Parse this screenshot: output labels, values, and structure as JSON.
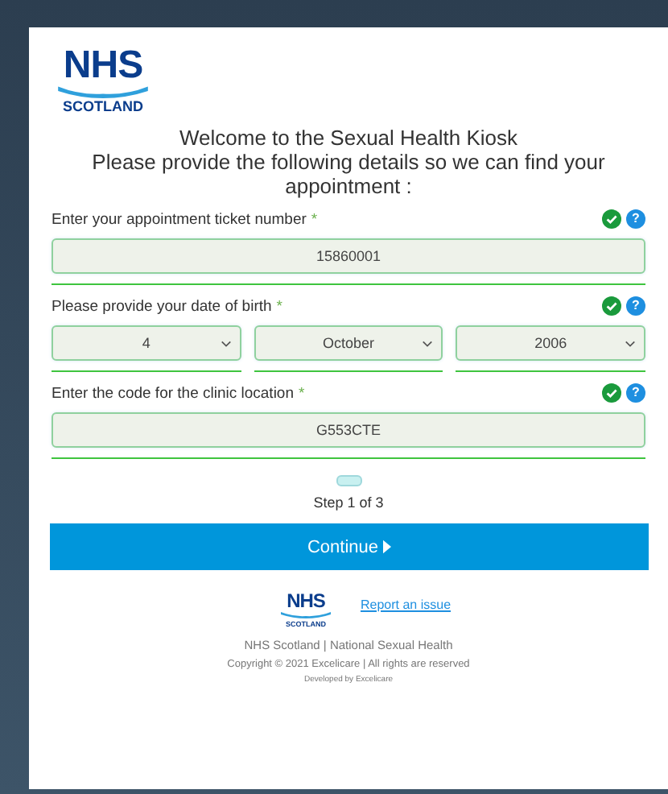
{
  "logo": {
    "name": "NHS",
    "region": "SCOTLAND"
  },
  "heading": [
    "Welcome to the Sexual Health Kiosk",
    "Please provide the following details so we can find your appointment :"
  ],
  "fields": [
    {
      "kind": "text",
      "label": "Enter your appointment ticket number",
      "required_mark": "*",
      "valid": true,
      "help": "?",
      "values": [
        "15860001"
      ]
    },
    {
      "kind": "select",
      "label": "Please provide your date of birth",
      "required_mark": "*",
      "valid": true,
      "help": "?",
      "values": [
        "4",
        "October",
        "2006"
      ]
    },
    {
      "kind": "text",
      "label": "Enter the code for the clinic location",
      "required_mark": "*",
      "valid": true,
      "help": "?",
      "values": [
        "G553CTE"
      ]
    }
  ],
  "step": "Step 1 of 3",
  "continue_button": "Continue",
  "footer": {
    "logo": {
      "name": "NHS",
      "region": "SCOTLAND"
    },
    "link": "Report an issue",
    "lines": [
      "NHS Scotland | National Sexual Health",
      "Copyright © 2021 Excelicare | All rights are reserved",
      "Developed by Excelicare"
    ]
  }
}
